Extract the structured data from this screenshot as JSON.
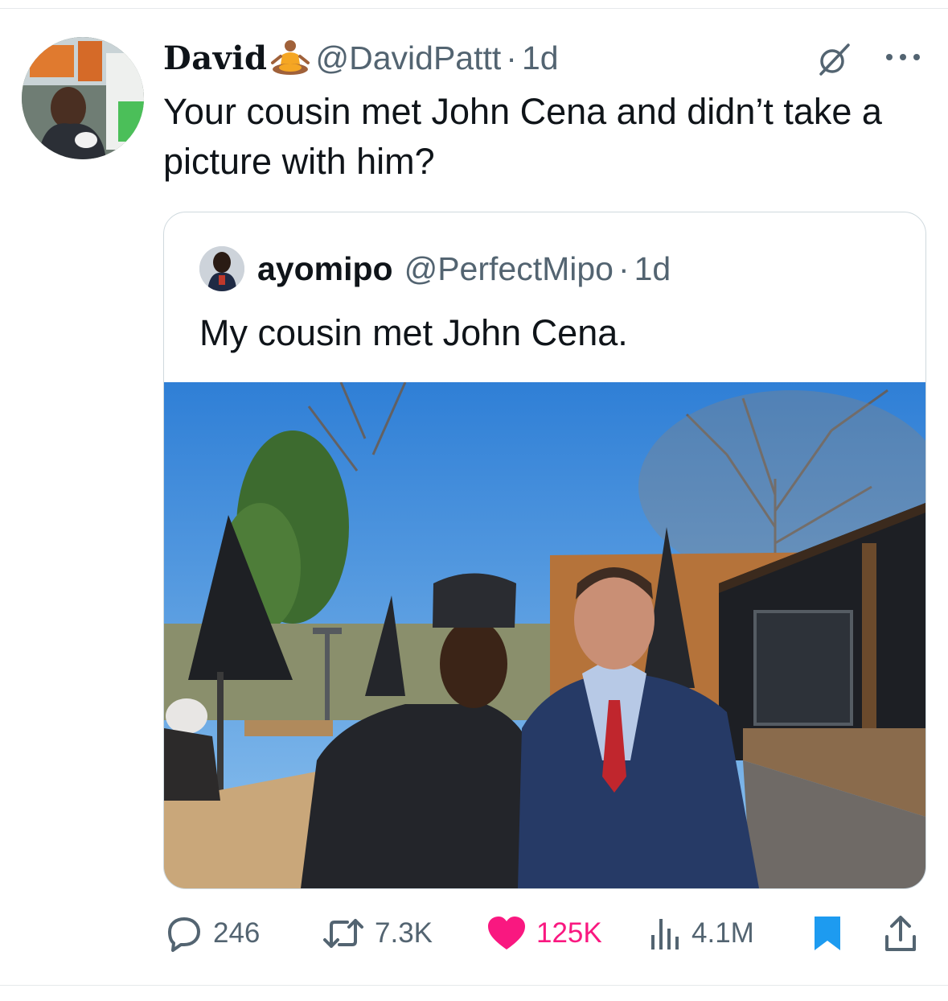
{
  "tweet": {
    "display_name": "David",
    "display_emoji": "person-in-lotus-position-emoji",
    "handle": "@DavidPattt",
    "separator": "·",
    "time": "1d",
    "text": "Your cousin met John Cena and didn’t take a picture with him?",
    "grok_icon": "grok-icon",
    "more_icon": "more-icon"
  },
  "quote": {
    "display_name": "ayomipo",
    "handle": "@PerfectMipo",
    "separator": "·",
    "time": "1d",
    "text": "My cousin met John Cena."
  },
  "actions": {
    "reply_count": "246",
    "retweet_count": "7.3K",
    "like_count": "125K",
    "views_count": "4.1M",
    "liked": true,
    "bookmarked": true
  },
  "colors": {
    "text": "#0f1419",
    "secondary": "#536471",
    "like": "#f91880",
    "bookmark": "#1d9bf0",
    "border": "#cfd9de"
  }
}
